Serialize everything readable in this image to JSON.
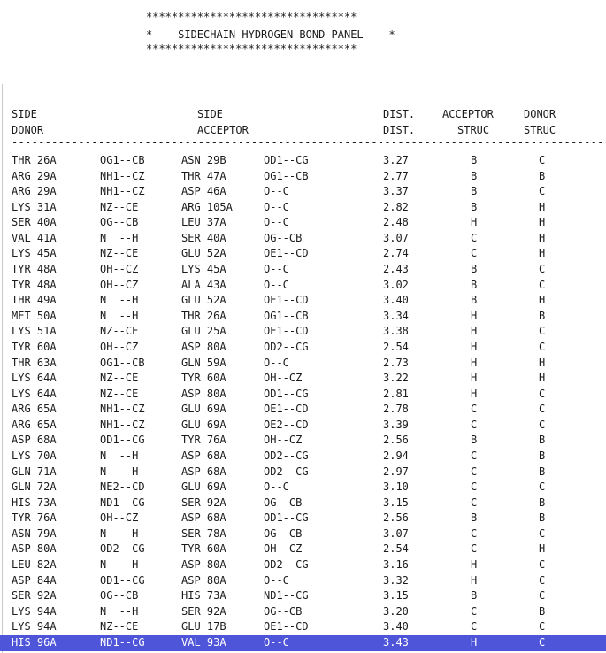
{
  "banner": {
    "top_border": "*********************************",
    "title_line": "*    SIDECHAIN HYDROGEN BOND PANEL    *",
    "bottom_border": "*********************************"
  },
  "headers": {
    "side_donor_1": "SIDE",
    "side_donor_2": "DONOR",
    "side_acceptor_1": "SIDE",
    "side_acceptor_2": "ACCEPTOR",
    "dist_1": "DIST.",
    "dist_2": "DIST.",
    "acceptor_struc_1": "ACCEPTOR",
    "acceptor_struc_2": "STRUC",
    "donor_struc_1": "DONOR",
    "donor_struc_2": "STRUC"
  },
  "rule": "--------------------------------------------------------------------------------------------",
  "selected_row": 31,
  "rows": [
    {
      "donor_res": "THR 26A",
      "donor_atoms": "OG1--CB",
      "acceptor_res": "ASN 29B",
      "acceptor_atoms": "OD1--CG",
      "dist": "3.27",
      "acc_struc": "B",
      "don_struc": "C"
    },
    {
      "donor_res": "ARG 29A",
      "donor_atoms": "NH1--CZ",
      "acceptor_res": "THR 47A",
      "acceptor_atoms": "OG1--CB",
      "dist": "2.77",
      "acc_struc": "B",
      "don_struc": "B"
    },
    {
      "donor_res": "ARG 29A",
      "donor_atoms": "NH1--CZ",
      "acceptor_res": "ASP 46A",
      "acceptor_atoms": "O--C",
      "dist": "3.37",
      "acc_struc": "B",
      "don_struc": "C"
    },
    {
      "donor_res": "LYS 31A",
      "donor_atoms": "NZ--CE",
      "acceptor_res": "ARG 105A",
      "acceptor_atoms": "O--C",
      "dist": "2.82",
      "acc_struc": "B",
      "don_struc": "H"
    },
    {
      "donor_res": "SER 40A",
      "donor_atoms": "OG--CB",
      "acceptor_res": "LEU 37A",
      "acceptor_atoms": "O--C",
      "dist": "2.48",
      "acc_struc": "H",
      "don_struc": "H"
    },
    {
      "donor_res": "VAL 41A",
      "donor_atoms": "N  --H",
      "acceptor_res": "SER 40A",
      "acceptor_atoms": "OG--CB",
      "dist": "3.07",
      "acc_struc": "C",
      "don_struc": "H"
    },
    {
      "donor_res": "LYS 45A",
      "donor_atoms": "NZ--CE",
      "acceptor_res": "GLU 52A",
      "acceptor_atoms": "OE1--CD",
      "dist": "2.74",
      "acc_struc": "C",
      "don_struc": "H"
    },
    {
      "donor_res": "TYR 48A",
      "donor_atoms": "OH--CZ",
      "acceptor_res": "LYS 45A",
      "acceptor_atoms": "O--C",
      "dist": "2.43",
      "acc_struc": "B",
      "don_struc": "C"
    },
    {
      "donor_res": "TYR 48A",
      "donor_atoms": "OH--CZ",
      "acceptor_res": "ALA 43A",
      "acceptor_atoms": "O--C",
      "dist": "3.02",
      "acc_struc": "B",
      "don_struc": "C"
    },
    {
      "donor_res": "THR 49A",
      "donor_atoms": "N  --H",
      "acceptor_res": "GLU 52A",
      "acceptor_atoms": "OE1--CD",
      "dist": "3.40",
      "acc_struc": "B",
      "don_struc": "H"
    },
    {
      "donor_res": "MET 50A",
      "donor_atoms": "N  --H",
      "acceptor_res": "THR 26A",
      "acceptor_atoms": "OG1--CB",
      "dist": "3.34",
      "acc_struc": "H",
      "don_struc": "B"
    },
    {
      "donor_res": "LYS 51A",
      "donor_atoms": "NZ--CE",
      "acceptor_res": "GLU 25A",
      "acceptor_atoms": "OE1--CD",
      "dist": "3.38",
      "acc_struc": "H",
      "don_struc": "C"
    },
    {
      "donor_res": "TYR 60A",
      "donor_atoms": "OH--CZ",
      "acceptor_res": "ASP 80A",
      "acceptor_atoms": "OD2--CG",
      "dist": "2.54",
      "acc_struc": "H",
      "don_struc": "C"
    },
    {
      "donor_res": "THR 63A",
      "donor_atoms": "OG1--CB",
      "acceptor_res": "GLN 59A",
      "acceptor_atoms": "O--C",
      "dist": "2.73",
      "acc_struc": "H",
      "don_struc": "H"
    },
    {
      "donor_res": "LYS 64A",
      "donor_atoms": "NZ--CE",
      "acceptor_res": "TYR 60A",
      "acceptor_atoms": "OH--CZ",
      "dist": "3.22",
      "acc_struc": "H",
      "don_struc": "H"
    },
    {
      "donor_res": "LYS 64A",
      "donor_atoms": "NZ--CE",
      "acceptor_res": "ASP 80A",
      "acceptor_atoms": "OD1--CG",
      "dist": "2.81",
      "acc_struc": "H",
      "don_struc": "C"
    },
    {
      "donor_res": "ARG 65A",
      "donor_atoms": "NH1--CZ",
      "acceptor_res": "GLU 69A",
      "acceptor_atoms": "OE1--CD",
      "dist": "2.78",
      "acc_struc": "C",
      "don_struc": "C"
    },
    {
      "donor_res": "ARG 65A",
      "donor_atoms": "NH1--CZ",
      "acceptor_res": "GLU 69A",
      "acceptor_atoms": "OE2--CD",
      "dist": "3.39",
      "acc_struc": "C",
      "don_struc": "C"
    },
    {
      "donor_res": "ASP 68A",
      "donor_atoms": "OD1--CG",
      "acceptor_res": "TYR 76A",
      "acceptor_atoms": "OH--CZ",
      "dist": "2.56",
      "acc_struc": "B",
      "don_struc": "B"
    },
    {
      "donor_res": "LYS 70A",
      "donor_atoms": "N  --H",
      "acceptor_res": "ASP 68A",
      "acceptor_atoms": "OD2--CG",
      "dist": "2.94",
      "acc_struc": "C",
      "don_struc": "B"
    },
    {
      "donor_res": "GLN 71A",
      "donor_atoms": "N  --H",
      "acceptor_res": "ASP 68A",
      "acceptor_atoms": "OD2--CG",
      "dist": "2.97",
      "acc_struc": "C",
      "don_struc": "B"
    },
    {
      "donor_res": "GLN 72A",
      "donor_atoms": "NE2--CD",
      "acceptor_res": "GLU 69A",
      "acceptor_atoms": "O--C",
      "dist": "3.10",
      "acc_struc": "C",
      "don_struc": "C"
    },
    {
      "donor_res": "HIS 73A",
      "donor_atoms": "ND1--CG",
      "acceptor_res": "SER 92A",
      "acceptor_atoms": "OG--CB",
      "dist": "3.15",
      "acc_struc": "C",
      "don_struc": "B"
    },
    {
      "donor_res": "TYR 76A",
      "donor_atoms": "OH--CZ",
      "acceptor_res": "ASP 68A",
      "acceptor_atoms": "OD1--CG",
      "dist": "2.56",
      "acc_struc": "B",
      "don_struc": "B"
    },
    {
      "donor_res": "ASN 79A",
      "donor_atoms": "N  --H",
      "acceptor_res": "SER 78A",
      "acceptor_atoms": "OG--CB",
      "dist": "3.07",
      "acc_struc": "C",
      "don_struc": "C"
    },
    {
      "donor_res": "ASP 80A",
      "donor_atoms": "OD2--CG",
      "acceptor_res": "TYR 60A",
      "acceptor_atoms": "OH--CZ",
      "dist": "2.54",
      "acc_struc": "C",
      "don_struc": "H"
    },
    {
      "donor_res": "LEU 82A",
      "donor_atoms": "N  --H",
      "acceptor_res": "ASP 80A",
      "acceptor_atoms": "OD2--CG",
      "dist": "3.16",
      "acc_struc": "H",
      "don_struc": "C"
    },
    {
      "donor_res": "ASP 84A",
      "donor_atoms": "OD1--CG",
      "acceptor_res": "ASP 80A",
      "acceptor_atoms": "O--C",
      "dist": "3.32",
      "acc_struc": "H",
      "don_struc": "C"
    },
    {
      "donor_res": "SER 92A",
      "donor_atoms": "OG--CB",
      "acceptor_res": "HIS 73A",
      "acceptor_atoms": "ND1--CG",
      "dist": "3.15",
      "acc_struc": "B",
      "don_struc": "C"
    },
    {
      "donor_res": "LYS 94A",
      "donor_atoms": "N  --H",
      "acceptor_res": "SER 92A",
      "acceptor_atoms": "OG--CB",
      "dist": "3.20",
      "acc_struc": "C",
      "don_struc": "B"
    },
    {
      "donor_res": "LYS 94A",
      "donor_atoms": "NZ--CE",
      "acceptor_res": "GLU 17B",
      "acceptor_atoms": "OE1--CD",
      "dist": "3.40",
      "acc_struc": "C",
      "don_struc": "C"
    },
    {
      "donor_res": "HIS 96A",
      "donor_atoms": "ND1--CG",
      "acceptor_res": "VAL 93A",
      "acceptor_atoms": "O--C",
      "dist": "3.43",
      "acc_struc": "H",
      "don_struc": "C"
    }
  ]
}
